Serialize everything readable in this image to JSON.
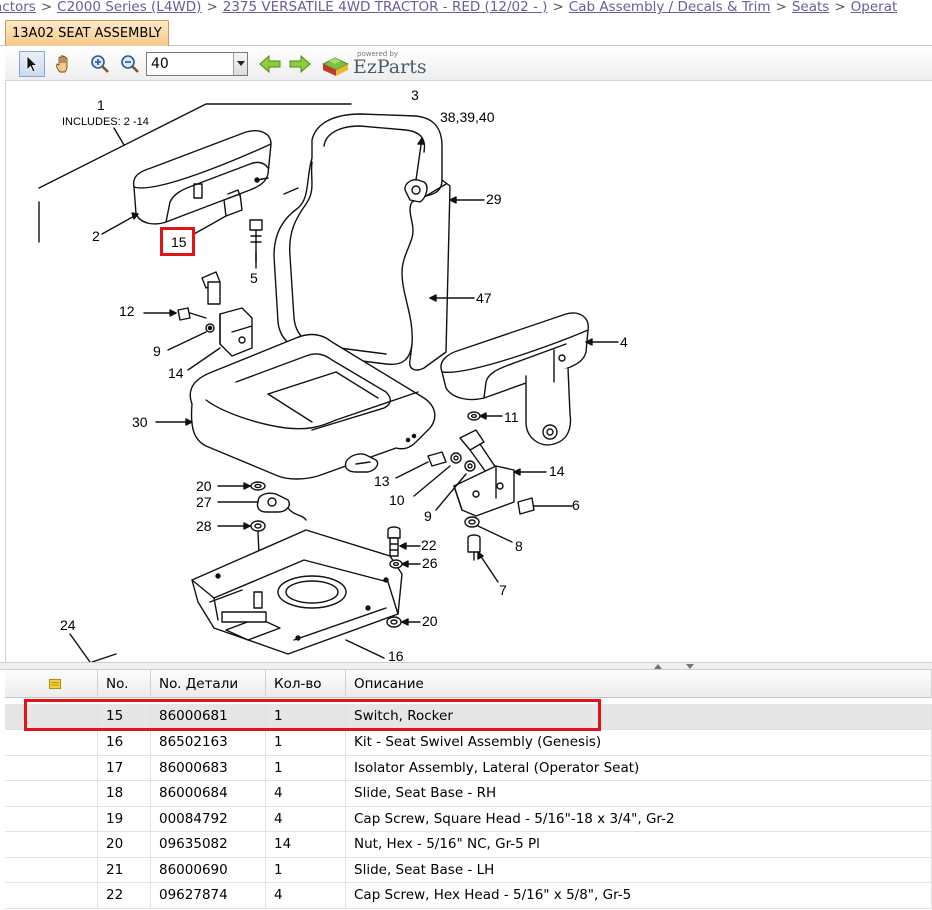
{
  "breadcrumb": [
    "actors",
    "C2000 Series (L4WD)",
    "2375 VERSATILE 4WD TRACTOR - RED (12/02 - )",
    "Cab Assembly / Decals & Trim",
    "Seats",
    "Operat"
  ],
  "breadcrumb_separator": ">",
  "tab": {
    "label": "13A02 SEAT ASSEMBLY"
  },
  "toolbar": {
    "zoom_value": "40",
    "tools": [
      "pointer-icon",
      "pan-hand-icon",
      "zoom-in-icon",
      "zoom-out-icon",
      "back-arrow-icon",
      "forward-arrow-icon"
    ],
    "logo_powered": "powered by",
    "logo_text": "EzParts"
  },
  "diagram": {
    "callouts": {
      "c1": "1",
      "includes": "INCLUDES:  2 -14",
      "c2": "2",
      "c3": "3",
      "c4": "4",
      "c5": "5",
      "c6": "6",
      "c7": "7",
      "c8": "8",
      "c9a": "9",
      "c9b": "9",
      "c10": "10",
      "c11": "11",
      "c12": "12",
      "c13": "13",
      "c14a": "14",
      "c14b": "14",
      "c15": "15",
      "c16": "16",
      "c20a": "20",
      "c20b": "20",
      "c22": "22",
      "c24": "24",
      "c26": "26",
      "c27": "27",
      "c28": "28",
      "c29": "29",
      "c30": "30",
      "c38": "38,39,40",
      "c47": "47"
    },
    "highlight_color": "#e01414"
  },
  "table": {
    "columns": [
      "",
      "No.",
      "No. Детали",
      "Кол-во",
      "Описание"
    ],
    "rows": [
      {
        "no": "15",
        "part": "86000681",
        "qty": "1",
        "desc": "Switch, Rocker",
        "selected": true
      },
      {
        "no": "16",
        "part": "86502163",
        "qty": "1",
        "desc": "Kit - Seat Swivel Assembly (Genesis)"
      },
      {
        "no": "17",
        "part": "86000683",
        "qty": "1",
        "desc": "Isolator Assembly, Lateral (Operator Seat)"
      },
      {
        "no": "18",
        "part": "86000684",
        "qty": "4",
        "desc": "Slide, Seat Base - RH"
      },
      {
        "no": "19",
        "part": "00084792",
        "qty": "4",
        "desc": "Cap Screw, Square Head - 5/16\"-18 x 3/4\", Gr-2"
      },
      {
        "no": "20",
        "part": "09635082",
        "qty": "14",
        "desc": "Nut, Hex - 5/16\" NC, Gr-5 Pl"
      },
      {
        "no": "21",
        "part": "86000690",
        "qty": "1",
        "desc": "Slide, Seat Base - LH"
      },
      {
        "no": "22",
        "part": "09627874",
        "qty": "4",
        "desc": "Cap Screw, Hex Head - 5/16\" x 5/8\", Gr-5"
      }
    ]
  },
  "colors": {
    "breadcrumb": "#6b5a9c",
    "tab_bg": "#f6c98a",
    "selection_row": "#e6e6e6",
    "highlight": "#e01414"
  }
}
